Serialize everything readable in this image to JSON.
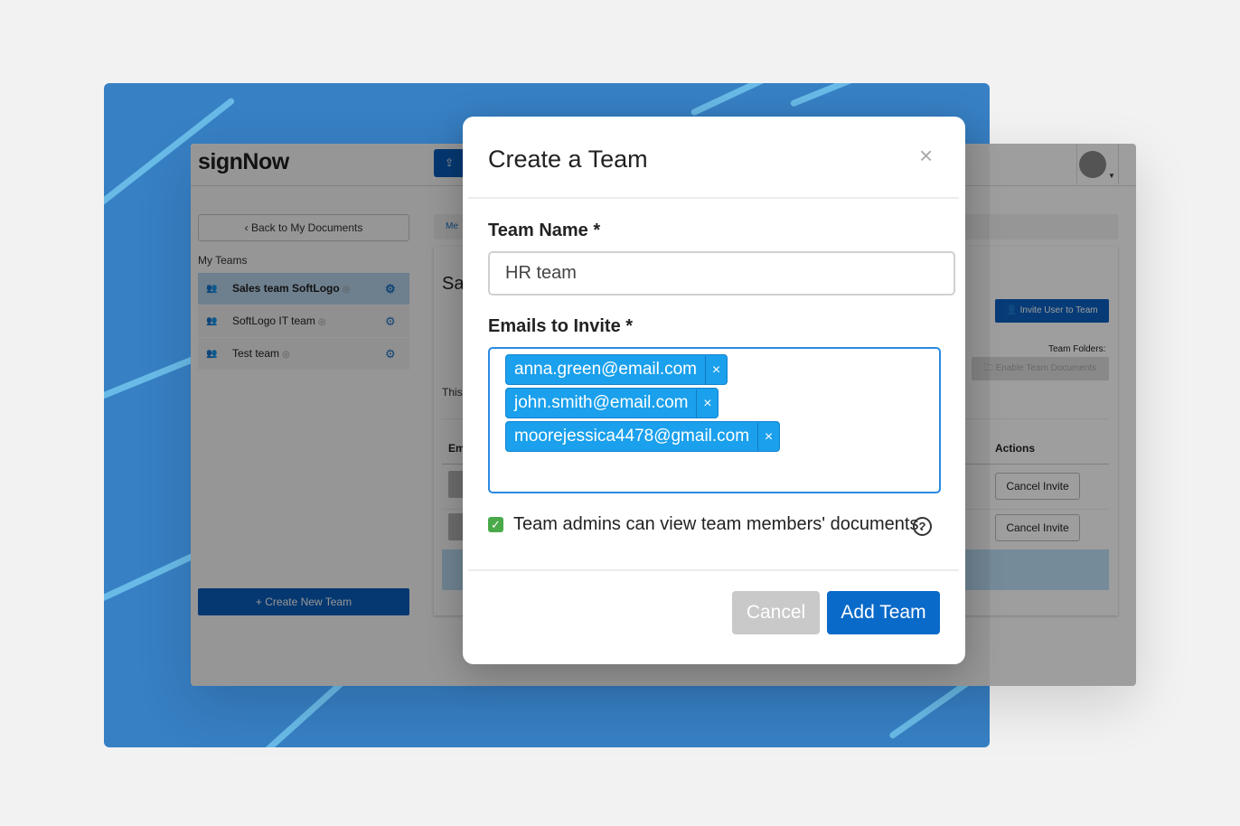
{
  "app": {
    "logo": "signNow",
    "upload_icon": "upload-icon",
    "back_label": "Back to My Documents",
    "my_teams_label": "My Teams",
    "teams": [
      {
        "label": "Sales team SoftLogo",
        "active": true
      },
      {
        "label": "SoftLogo IT team",
        "active": false
      },
      {
        "label": "Test team",
        "active": false
      }
    ],
    "create_team_label": "+ Create New Team",
    "breadcrumb": "Me",
    "main_title_partial": "Sa",
    "invite_label": "Invite User to Team",
    "team_folders_label": "Team Folders:",
    "enable_docs_label": "Enable Team Documents",
    "this_partial": "This",
    "col_email_partial": "Em",
    "col_actions": "Actions",
    "cancel_invite_1": "Cancel Invite",
    "cancel_invite_2": "Cancel Invite"
  },
  "modal": {
    "title": "Create a Team",
    "close_glyph": "×",
    "team_name_label": "Team Name *",
    "team_name_value": "HR team",
    "emails_label": "Emails to Invite *",
    "emails": [
      "anna.green@email.com",
      "john.smith@email.com",
      "moorejessica4478@gmail.com"
    ],
    "remove_glyph": "×",
    "checkbox_checked": true,
    "checkbox_label": "Team admins can view team members' documents.",
    "help_glyph": "?",
    "cancel_label": "Cancel",
    "add_label": "Add Team"
  },
  "colors": {
    "accent": "#0a6ac9",
    "tag": "#1aa0ec",
    "checkbox": "#4aaa4a",
    "background_panel": "#3a87cf"
  }
}
